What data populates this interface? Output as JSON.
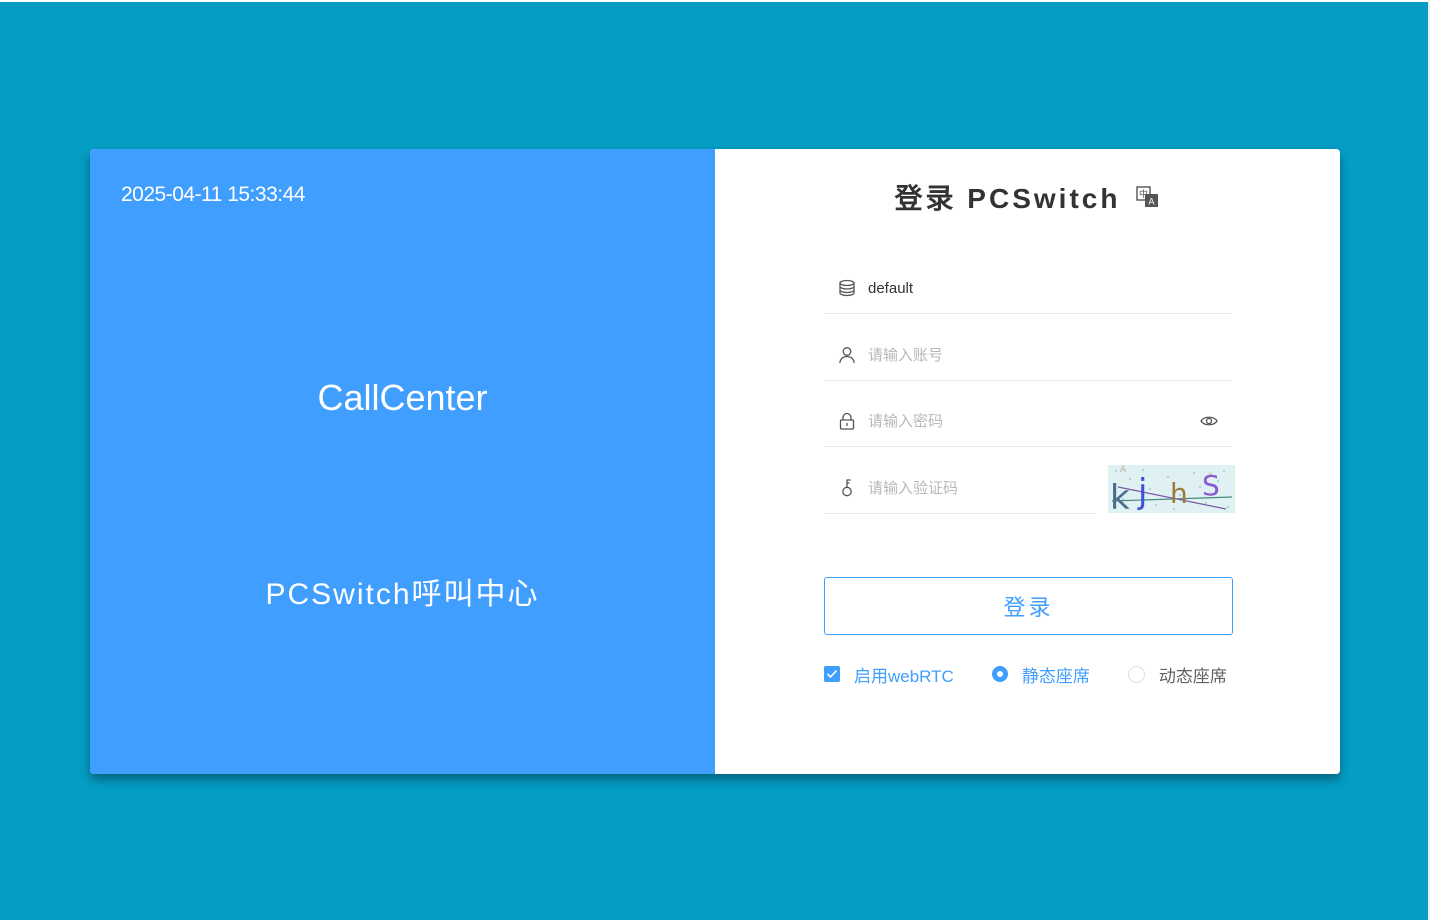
{
  "left_panel": {
    "datetime": "2025-04-11 15:33:44",
    "brand": "CallCenter",
    "slogan": "PCSwitch呼叫中心"
  },
  "login": {
    "title": "登录 PCSwitch",
    "tenant_value": "default",
    "account_placeholder": "请输入账号",
    "password_placeholder": "请输入密码",
    "captcha_placeholder": "请输入验证码",
    "captcha_text": "kjhS",
    "submit_label": "登录",
    "webrtc_label": "启用webRTC",
    "webrtc_checked": true,
    "seat_mode_options": [
      "静态座席",
      "动态座席"
    ],
    "seat_mode_selected": "静态座席"
  },
  "colors": {
    "background": "#059dc4",
    "primary": "#409eff",
    "title_text": "#333333"
  },
  "icons": {
    "tenant": "database-icon",
    "account": "user-icon",
    "password": "lock-icon",
    "captcha": "key-icon",
    "password_toggle": "eye-icon",
    "language": "translate-icon"
  }
}
